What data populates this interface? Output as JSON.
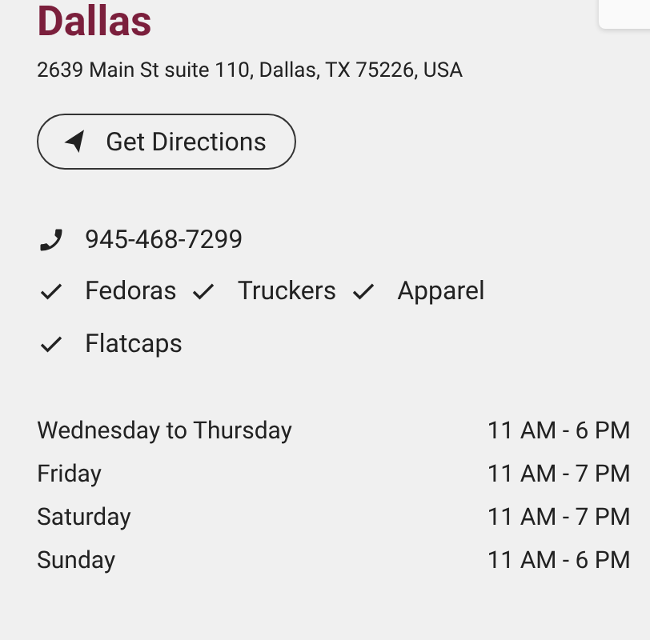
{
  "store": {
    "name": "Dallas",
    "address": "2639 Main St suite 110, Dallas, TX 75226, USA",
    "directions_button": "Get Directions",
    "phone": "945-468-7299"
  },
  "features": [
    {
      "label": "Fedoras",
      "checked": true
    },
    {
      "label": "Truckers",
      "checked": true
    },
    {
      "label": "Apparel",
      "checked": true
    },
    {
      "label": "Flatcaps",
      "checked": true
    }
  ],
  "hours": [
    {
      "days": "Wednesday to Thursday",
      "time": "11 AM - 6 PM"
    },
    {
      "days": "Friday",
      "time": "11 AM - 7 PM"
    },
    {
      "days": "Saturday",
      "time": "11 AM - 7 PM"
    },
    {
      "days": "Sunday",
      "time": "11 AM - 6 PM"
    }
  ]
}
